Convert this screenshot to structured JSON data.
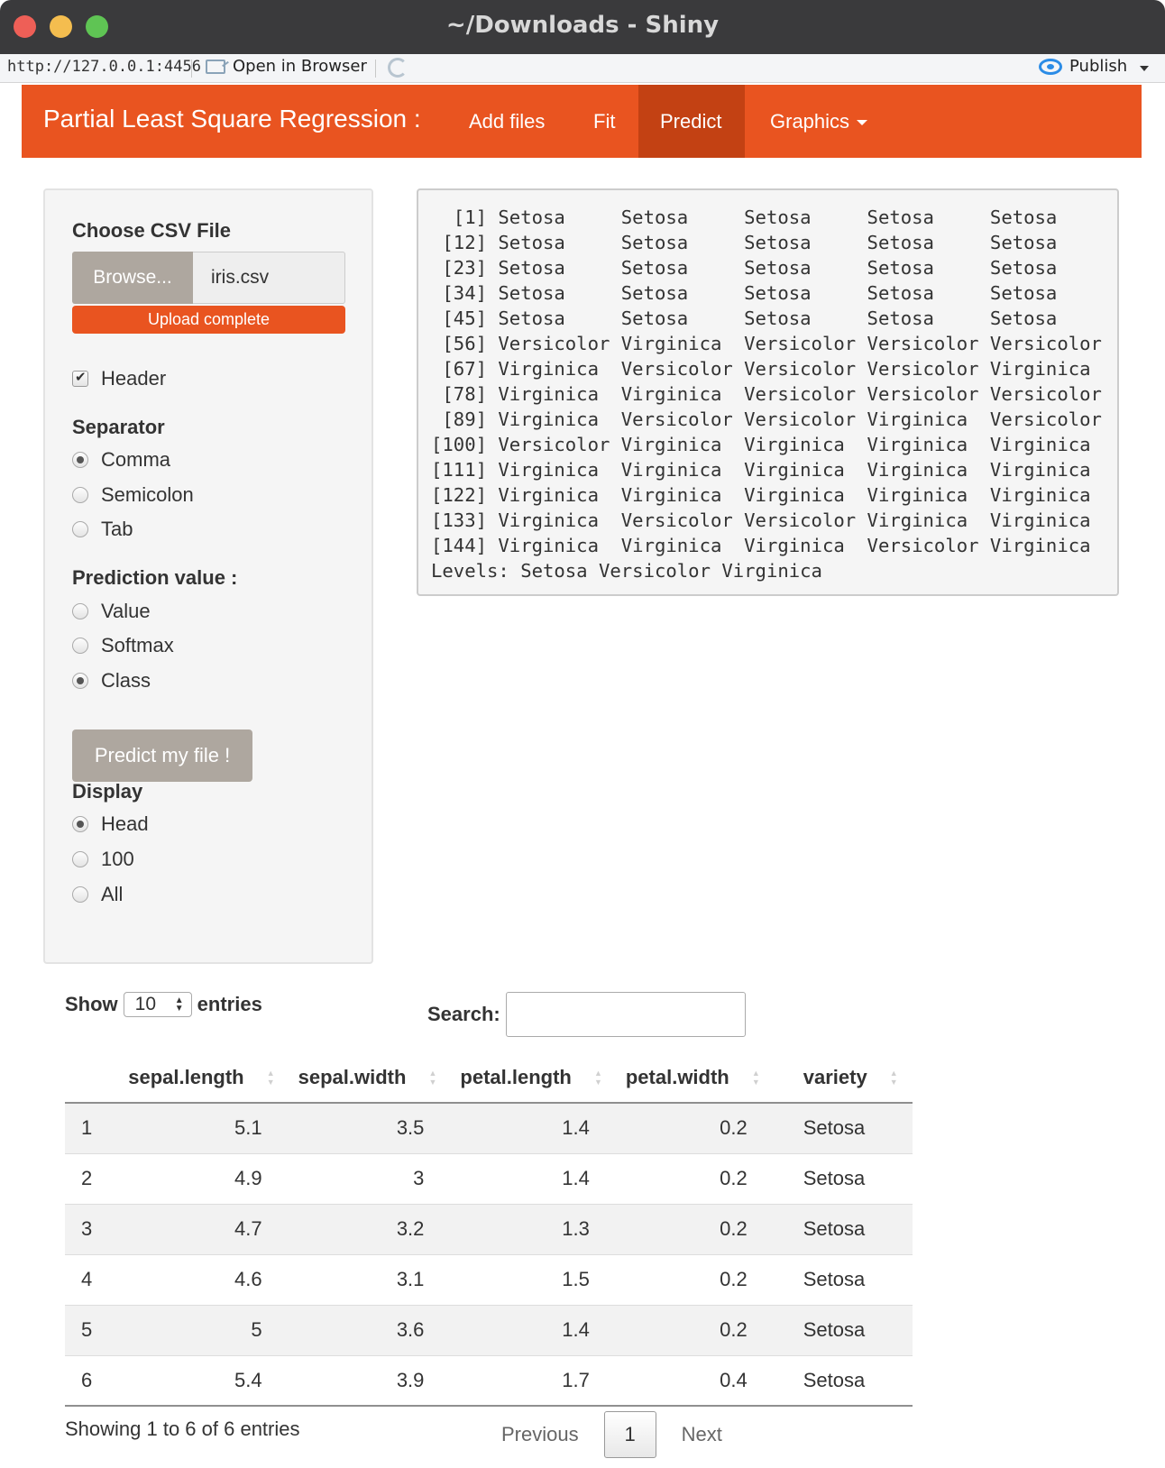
{
  "window": {
    "title": "~/Downloads - Shiny"
  },
  "toolbar": {
    "url": "http://127.0.0.1:4456",
    "open_label": "Open in Browser",
    "publish_label": "Publish"
  },
  "navbar": {
    "brand": "Partial Least Square Regression :",
    "tabs": [
      "Add files",
      "Fit",
      "Predict",
      "Graphics"
    ],
    "active_tab": "Predict",
    "accent_color": "#e95420"
  },
  "sidebar": {
    "file_label": "Choose CSV File",
    "browse_label": "Browse...",
    "file_name": "iris.csv",
    "upload_status": "Upload complete",
    "header_label": "Header",
    "header_checked": true,
    "separator_label": "Separator",
    "separator_options": [
      "Comma",
      "Semicolon",
      "Tab"
    ],
    "separator_selected": "Comma",
    "prediction_label": "Prediction value :",
    "prediction_options": [
      "Value",
      "Softmax",
      "Class"
    ],
    "prediction_selected": "Class",
    "predict_button": "Predict my file !",
    "display_label": "Display",
    "display_options": [
      "Head",
      "100",
      "All"
    ],
    "display_selected": "Head"
  },
  "output": {
    "text": "  [1] Setosa     Setosa     Setosa     Setosa     Setosa    \n [12] Setosa     Setosa     Setosa     Setosa     Setosa    \n [23] Setosa     Setosa     Setosa     Setosa     Setosa    \n [34] Setosa     Setosa     Setosa     Setosa     Setosa    \n [45] Setosa     Setosa     Setosa     Setosa     Setosa    \n [56] Versicolor Virginica  Versicolor Versicolor Versicolor\n [67] Virginica  Versicolor Versicolor Versicolor Virginica \n [78] Virginica  Virginica  Versicolor Versicolor Versicolor\n [89] Virginica  Versicolor Versicolor Virginica  Versicolor\n[100] Versicolor Virginica  Virginica  Virginica  Virginica \n[111] Virginica  Virginica  Virginica  Virginica  Virginica \n[122] Virginica  Virginica  Virginica  Virginica  Virginica \n[133] Virginica  Versicolor Versicolor Virginica  Virginica \n[144] Virginica  Virginica  Virginica  Versicolor Virginica \nLevels: Setosa Versicolor Virginica"
  },
  "table": {
    "show_label": "Show",
    "entries_label": "entries",
    "page_length": "10",
    "search_label": "Search:",
    "search_value": "",
    "columns": [
      "",
      "sepal.length",
      "sepal.width",
      "petal.length",
      "petal.width",
      "variety"
    ],
    "rows": [
      [
        "1",
        "5.1",
        "3.5",
        "1.4",
        "0.2",
        "Setosa"
      ],
      [
        "2",
        "4.9",
        "3",
        "1.4",
        "0.2",
        "Setosa"
      ],
      [
        "3",
        "4.7",
        "3.2",
        "1.3",
        "0.2",
        "Setosa"
      ],
      [
        "4",
        "4.6",
        "3.1",
        "1.5",
        "0.2",
        "Setosa"
      ],
      [
        "5",
        "5",
        "3.6",
        "1.4",
        "0.2",
        "Setosa"
      ],
      [
        "6",
        "5.4",
        "3.9",
        "1.7",
        "0.4",
        "Setosa"
      ]
    ],
    "info": "Showing 1 to 6 of 6 entries",
    "pagination": {
      "previous": "Previous",
      "current": "1",
      "next": "Next"
    }
  }
}
